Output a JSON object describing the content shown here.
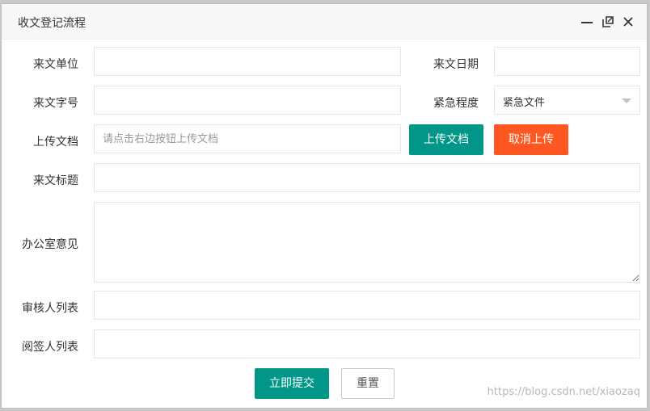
{
  "dialog": {
    "title": "收文登记流程",
    "controls": {
      "minimize": "minimize-icon",
      "maximize": "maximize-icon",
      "close": "close-icon"
    }
  },
  "form": {
    "source_unit": {
      "label": "来文单位",
      "value": ""
    },
    "source_date": {
      "label": "来文日期",
      "value": ""
    },
    "doc_number": {
      "label": "来文字号",
      "value": ""
    },
    "urgency": {
      "label": "紧急程度",
      "value": "紧急文件"
    },
    "upload": {
      "label": "上传文档",
      "placeholder": "请点击右边按钮上传文档",
      "upload_button": "上传文档",
      "cancel_button": "取消上传"
    },
    "doc_title": {
      "label": "来文标题",
      "value": ""
    },
    "office_opinion": {
      "label": "办公室意见",
      "value": ""
    },
    "reviewers": {
      "label": "审核人列表",
      "value": ""
    },
    "signers": {
      "label": "阅签人列表",
      "value": ""
    }
  },
  "actions": {
    "submit": "立即提交",
    "reset": "重置"
  },
  "watermark": "https://blog.csdn.net/xiaozaq",
  "colors": {
    "primary": "#009688",
    "danger": "#ff5722"
  }
}
